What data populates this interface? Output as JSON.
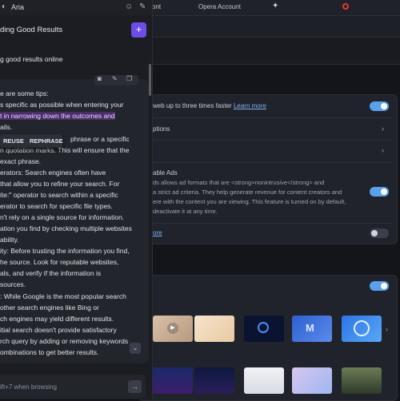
{
  "browser_tabs": [
    {
      "label": "ont"
    },
    {
      "label": "Opera Account"
    }
  ],
  "aria": {
    "title": "Aria",
    "chat_title": "ding Good Results",
    "new_chat_label": "+",
    "user_message": "g good results online",
    "reply_lines": [
      "e are some tips:",
      "s specific as possible when entering your",
      "t in narrowing down the outcomes and",
      "ails.",
      "phrase or a specific",
      "n quotation marks. This will ensure that the",
      "exact phrase.",
      "erators: Search engines often have",
      "that allow you to refine your search. For",
      "ite:\" operator to search within a specific",
      "erator to search for specific file types.",
      "n't rely on a single source for information.",
      "ation you find by checking multiple websites",
      "ability.",
      "ity: Before trusting the information you find,",
      "he source. Look for reputable websites,",
      "als, and verify if the information is",
      "sources.",
      ": While Google is the most popular search",
      "other search engines like Bing or",
      "ch engines may yield different results.",
      "itial search doesn't provide satisfactory",
      "rch query by adding or removing keywords",
      "ombinations to get better results."
    ],
    "popup": {
      "reuse": "REUSE",
      "rephrase": "REPHRASE"
    },
    "input_placeholder": "ift+7 when browsing"
  },
  "settings": {
    "row1_text": "web up to three times faster",
    "row1_link": "Learn more",
    "row2_text": "ptions",
    "ads_title": "able Ads",
    "ads_desc": [
      "ds allows ad formats that are <strong>nonintrusive</strong> and",
      "a strict ad criteria. They help generate revenue for content creators and",
      "ere with the content you are viewing. This feature is turned on by default,",
      "deactivate it at any time."
    ],
    "more_link": "ore",
    "toggles": {
      "row1": true,
      "ads": true,
      "more": false,
      "wallpapers": true
    }
  },
  "colors": {
    "accent": "#6d4ce8",
    "toggle_on": "#5aa0ea",
    "highlight": "#4b2c6d"
  }
}
